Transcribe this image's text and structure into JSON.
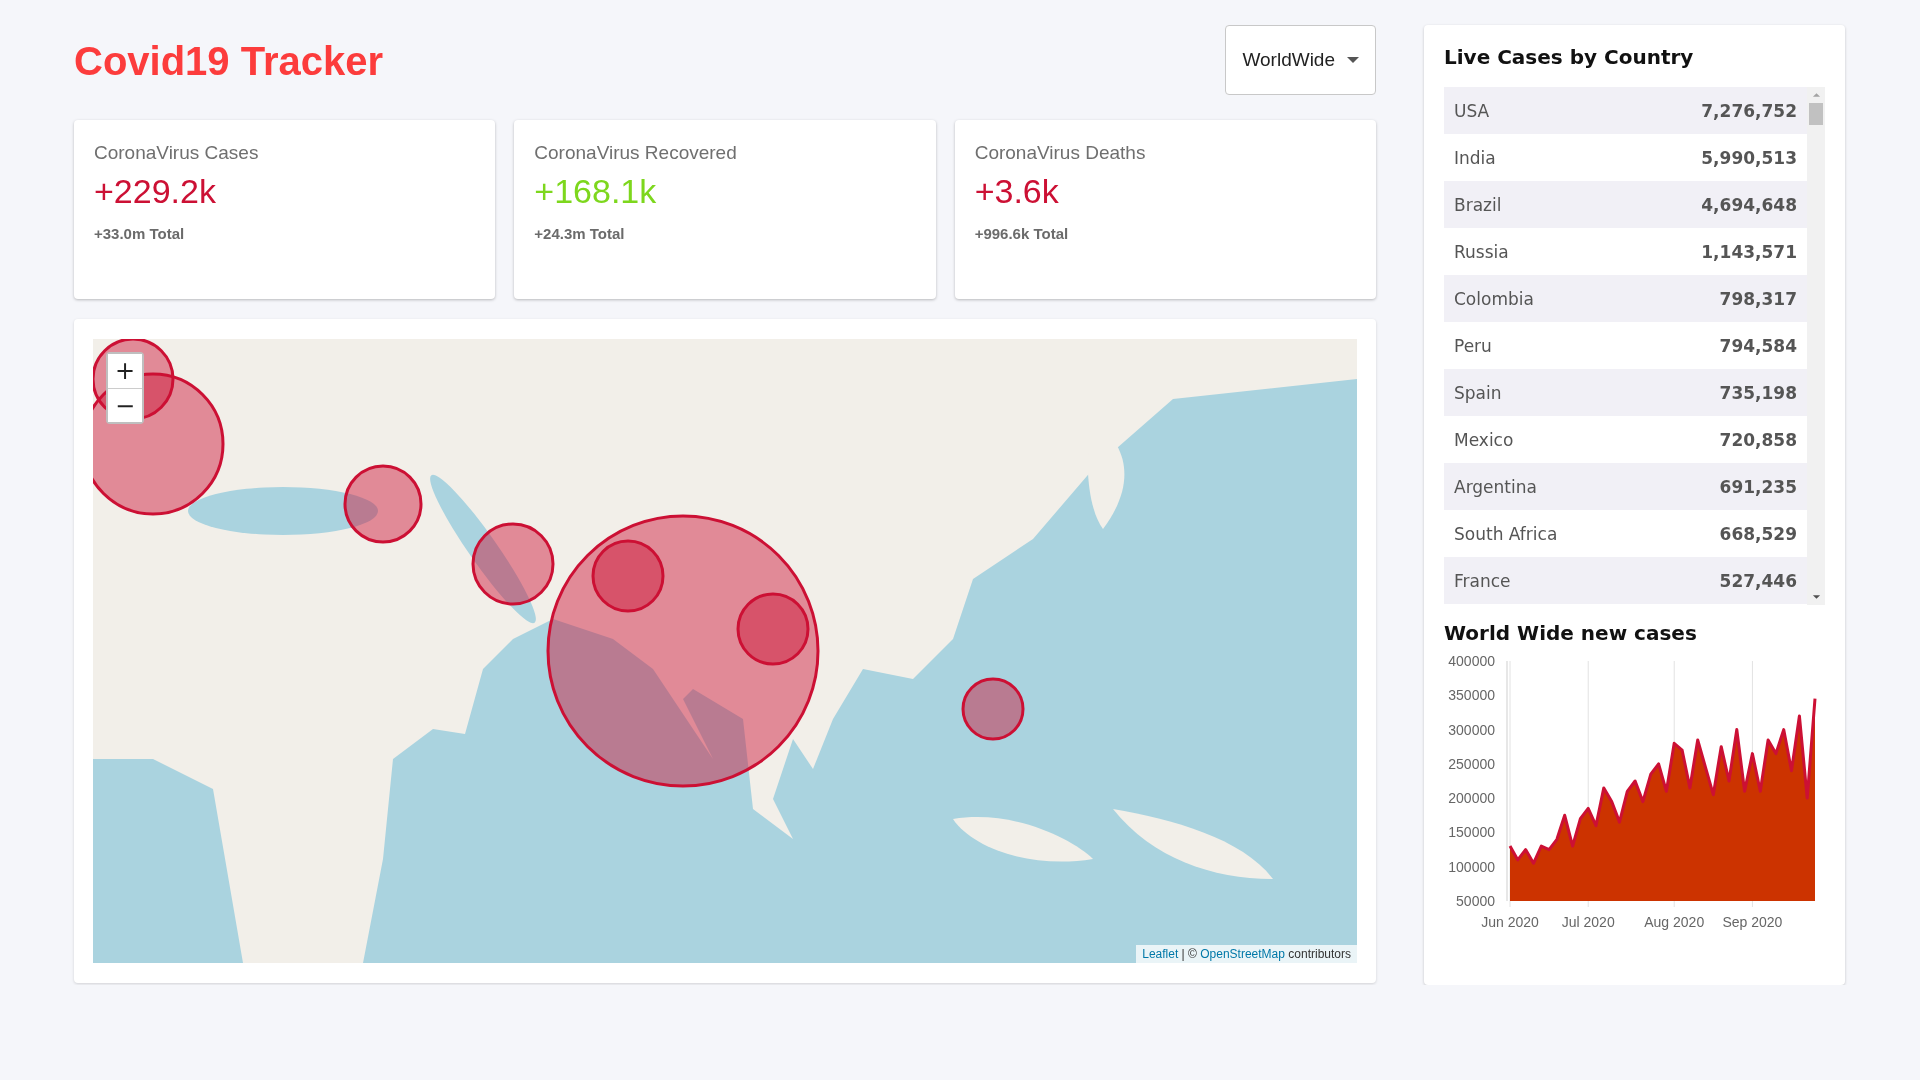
{
  "header": {
    "title": "Covid19 Tracker",
    "dropdown": {
      "value": "WorldWide"
    }
  },
  "info_cards": [
    {
      "kind": "cases",
      "title": "CoronaVirus Cases",
      "value": "+229.2k",
      "total": "+33.0m Total"
    },
    {
      "kind": "recovered",
      "title": "CoronaVirus Recovered",
      "value": "+168.1k",
      "total": "+24.3m Total"
    },
    {
      "kind": "deaths",
      "title": "CoronaVirus Deaths",
      "value": "+3.6k",
      "total": "+996.6k Total"
    }
  ],
  "map": {
    "kind": "picture",
    "zoom_in": "+",
    "zoom_out": "−",
    "attribution": {
      "link_1": "Leaflet",
      "separator": " | © ",
      "link_2": "OpenStreetMap",
      "suffix": " contributors"
    }
  },
  "sidebar": {
    "title": "Live Cases by Country",
    "countries": [
      {
        "name": "USA",
        "cases": "7,276,752"
      },
      {
        "name": "India",
        "cases": "5,990,513"
      },
      {
        "name": "Brazil",
        "cases": "4,694,648"
      },
      {
        "name": "Russia",
        "cases": "1,143,571"
      },
      {
        "name": "Colombia",
        "cases": "798,317"
      },
      {
        "name": "Peru",
        "cases": "794,584"
      },
      {
        "name": "Spain",
        "cases": "735,198"
      },
      {
        "name": "Mexico",
        "cases": "720,858"
      },
      {
        "name": "Argentina",
        "cases": "691,235"
      },
      {
        "name": "South Africa",
        "cases": "668,529"
      },
      {
        "name": "France",
        "cases": "527,446"
      }
    ],
    "chart_title": "World Wide new cases",
    "chart_data": {
      "type": "area",
      "grid": true,
      "ylim": [
        50000,
        400000
      ],
      "yticks": [
        50000,
        100000,
        150000,
        200000,
        250000,
        300000,
        350000,
        400000
      ],
      "categories": [
        "Jun 2020",
        null,
        null,
        null,
        null,
        null,
        null,
        null,
        null,
        null,
        "Jul 2020",
        null,
        null,
        null,
        null,
        null,
        null,
        null,
        null,
        null,
        null,
        "Aug 2020",
        null,
        null,
        null,
        null,
        null,
        null,
        null,
        null,
        null,
        "Sep 2020",
        null,
        null,
        null,
        null,
        null,
        null,
        null,
        null
      ],
      "series": [
        {
          "color": "#cc1034",
          "values": [
            130000,
            110000,
            125000,
            105000,
            130000,
            125000,
            140000,
            175000,
            130000,
            170000,
            185000,
            160000,
            215000,
            195000,
            165000,
            210000,
            225000,
            195000,
            235000,
            250000,
            210000,
            280000,
            270000,
            215000,
            285000,
            245000,
            205000,
            275000,
            225000,
            300000,
            210000,
            265000,
            210000,
            285000,
            265000,
            300000,
            240000,
            320000,
            200000,
            345000
          ]
        }
      ]
    }
  }
}
